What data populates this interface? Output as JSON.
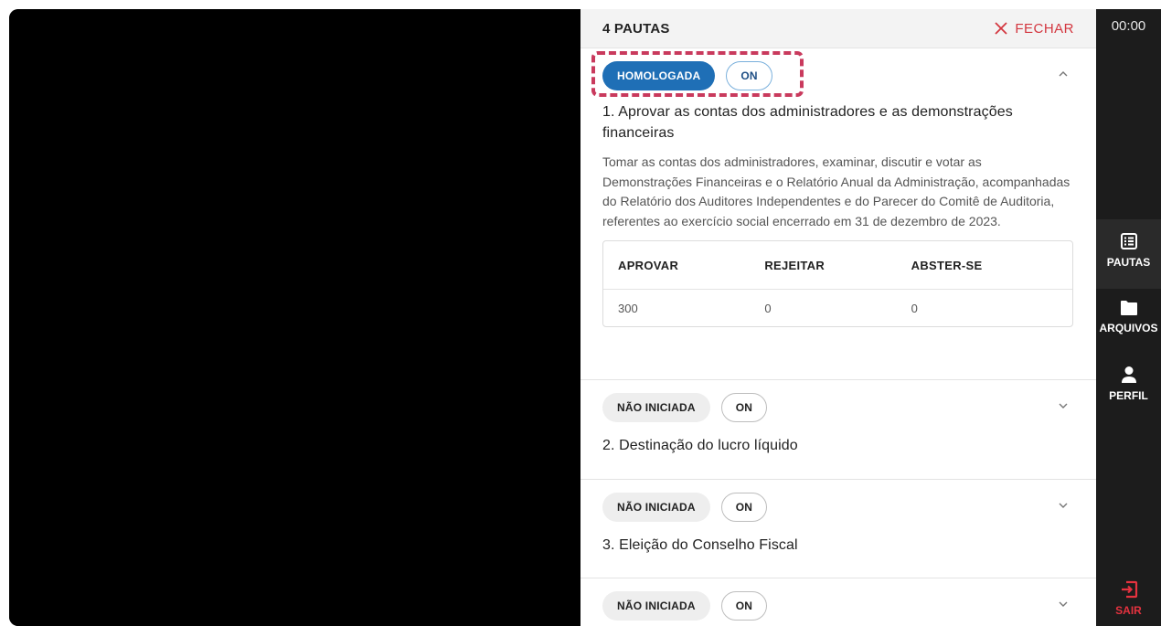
{
  "header": {
    "title": "4 PAUTAS",
    "close_label": "FECHAR"
  },
  "sidebar": {
    "timer": "00:00",
    "items": [
      {
        "label": "PAUTAS",
        "icon": "list-icon"
      },
      {
        "label": "ARQUIVOS",
        "icon": "folder-icon"
      },
      {
        "label": "PERFIL",
        "icon": "user-icon"
      }
    ],
    "exit_label": "SAIR"
  },
  "items": [
    {
      "status": "HOMOLOGADA",
      "mode": "ON",
      "title": "1. Aprovar as contas dos administradores e as demonstrações financeiras",
      "description": "Tomar as contas dos administradores, examinar, discutir e votar as Demonstrações Financeiras e o Relatório Anual da Administração, acompanhadas do Relatório dos Auditores Independentes e do Parecer do Comitê de Auditoria, referentes ao exercício social encerrado em 31 de dezembro de 2023.",
      "votes": {
        "headers": [
          "APROVAR",
          "REJEITAR",
          "ABSTER-SE"
        ],
        "values": [
          "300",
          "0",
          "0"
        ]
      }
    },
    {
      "status": "NÃO INICIADA",
      "mode": "ON",
      "title": "2. Destinação do lucro líquido"
    },
    {
      "status": "NÃO INICIADA",
      "mode": "ON",
      "title": "3. Eleição do Conselho Fiscal"
    },
    {
      "status": "NÃO INICIADA",
      "mode": "ON"
    }
  ],
  "colors": {
    "accent": "#1f6fb6",
    "danger": "#d3363f",
    "highlight": "#c93a5d",
    "sidebar": "#1c1c1c"
  }
}
